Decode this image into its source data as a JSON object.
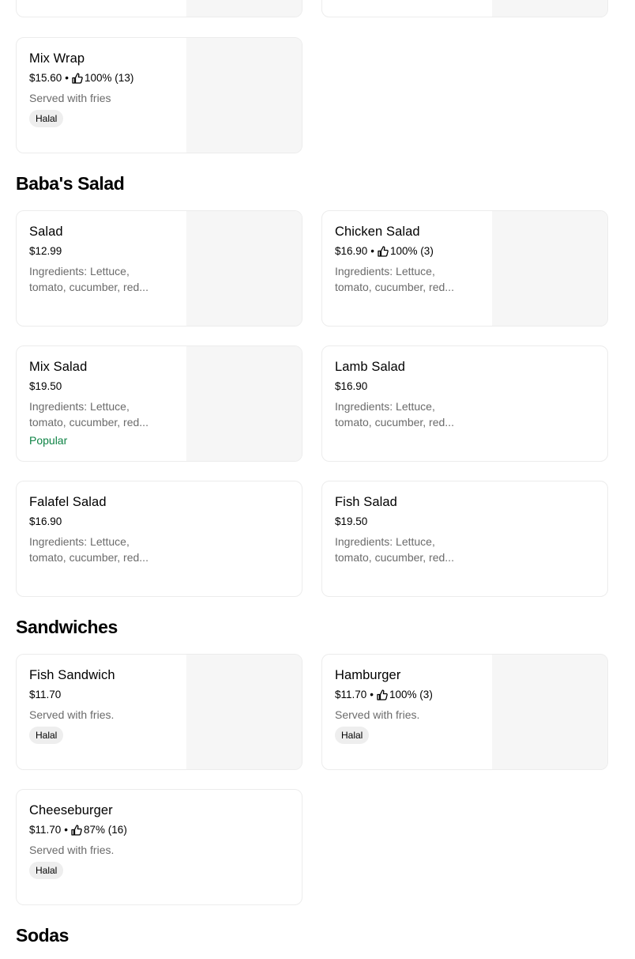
{
  "sections": {
    "salad": {
      "title": "Baba's Salad"
    },
    "sandwiches": {
      "title": "Sandwiches"
    },
    "sodas": {
      "title": "Sodas"
    }
  },
  "items": {
    "mix_wrap": {
      "name": "Mix Wrap",
      "price": "$15.60",
      "dot": "•",
      "rating": "100% (13)",
      "desc": "Served with fries",
      "badge": "Halal"
    },
    "salad": {
      "name": "Salad",
      "price": "$12.99",
      "desc": "Ingredients: Lettuce, tomato, cucumber, red..."
    },
    "chicken_salad": {
      "name": "Chicken Salad",
      "price": "$16.90",
      "dot": "•",
      "rating": "100% (3)",
      "desc": "Ingredients: Lettuce, tomato, cucumber, red..."
    },
    "mix_salad": {
      "name": "Mix Salad",
      "price": "$19.50",
      "desc": "Ingredients: Lettuce, tomato, cucumber, red...",
      "tag": "Popular"
    },
    "lamb_salad": {
      "name": "Lamb Salad",
      "price": "$16.90",
      "desc": "Ingredients: Lettuce, tomato, cucumber, red..."
    },
    "falafel_salad": {
      "name": "Falafel Salad",
      "price": "$16.90",
      "desc": "Ingredients: Lettuce, tomato, cucumber, red..."
    },
    "fish_salad": {
      "name": "Fish Salad",
      "price": "$19.50",
      "desc": "Ingredients: Lettuce, tomato, cucumber, red..."
    },
    "fish_sandwich": {
      "name": "Fish Sandwich",
      "price": "$11.70",
      "desc": "Served with fries.",
      "badge": "Halal"
    },
    "hamburger": {
      "name": "Hamburger",
      "price": "$11.70",
      "dot": "•",
      "rating": "100% (3)",
      "desc": "Served with fries.",
      "badge": "Halal"
    },
    "cheeseburger": {
      "name": "Cheeseburger",
      "price": "$11.70",
      "dot": "•",
      "rating": "87% (16)",
      "desc": "Served with fries.",
      "badge": "Halal"
    }
  },
  "icons": {
    "rating": "thumbs-up-icon"
  },
  "colors": {
    "popular": "#0e8345",
    "badge_bg": "#eeeeee",
    "image_placeholder": "#f6f6f6",
    "description": "#6b6b6b"
  }
}
